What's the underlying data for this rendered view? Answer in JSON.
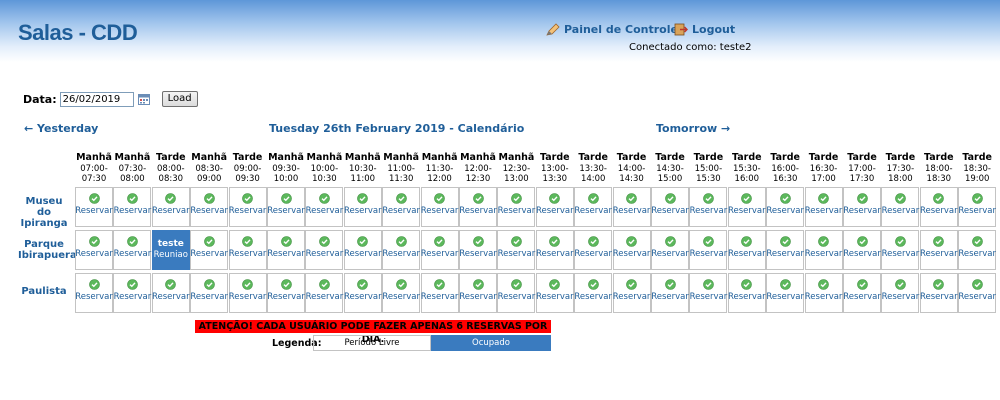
{
  "header": {
    "title": "Salas - CDD",
    "control_panel": "Painel de Controle",
    "logout": "Logout",
    "connected_as": "Conectado como: teste2"
  },
  "date_bar": {
    "label": "Data:",
    "value": "26/02/2019",
    "load_label": "Load"
  },
  "nav": {
    "prev": "← Yesterday",
    "title": "Tuesday 26th February 2019 - Calendário",
    "next": "Tomorrow →"
  },
  "slots": [
    {
      "period": "Manhã",
      "time": "07:00-\n07:30"
    },
    {
      "period": "Manhã",
      "time": "07:30-\n08:00"
    },
    {
      "period": "Tarde",
      "time": "08:00-\n08:30"
    },
    {
      "period": "Manhã",
      "time": "08:30-\n09:00"
    },
    {
      "period": "Tarde",
      "time": "09:00-\n09:30"
    },
    {
      "period": "Manhã",
      "time": "09:30-\n10:00"
    },
    {
      "period": "Manhã",
      "time": "10:00-\n10:30"
    },
    {
      "period": "Manhã",
      "time": "10:30-\n11:00"
    },
    {
      "period": "Manhã",
      "time": "11:00-\n11:30"
    },
    {
      "period": "Manhã",
      "time": "11:30-\n12:00"
    },
    {
      "period": "Manhã",
      "time": "12:00-\n12:30"
    },
    {
      "period": "Manhã",
      "time": "12:30-\n13:00"
    },
    {
      "period": "Tarde",
      "time": "13:00-\n13:30"
    },
    {
      "period": "Tarde",
      "time": "13:30-\n14:00"
    },
    {
      "period": "Tarde",
      "time": "14:00-\n14:30"
    },
    {
      "period": "Tarde",
      "time": "14:30-\n15:00"
    },
    {
      "period": "Tarde",
      "time": "15:00-\n15:30"
    },
    {
      "period": "Tarde",
      "time": "15:30-\n16:00"
    },
    {
      "period": "Tarde",
      "time": "16:00-\n16:30"
    },
    {
      "period": "Tarde",
      "time": "16:30-\n17:00"
    },
    {
      "period": "Tarde",
      "time": "17:00-\n17:30"
    },
    {
      "period": "Tarde",
      "time": "17:30-\n18:00"
    },
    {
      "period": "Tarde",
      "time": "18:00-\n18:30"
    },
    {
      "period": "Tarde",
      "time": "18:30-\n19:00"
    }
  ],
  "rooms": [
    {
      "name": "Museu do\nIpiranga",
      "busy": []
    },
    {
      "name": "Parque\nIbirapuera",
      "busy": [
        {
          "slot": 2,
          "title": "teste",
          "subtitle": "Reuniao"
        }
      ]
    },
    {
      "name": "Paulista",
      "busy": []
    }
  ],
  "reserve_label": "Reservar",
  "warning": "ATENÇÃO! CADA USUÁRIO PODE FAZER APENAS 6 RESERVAS POR DIA.",
  "legend": {
    "label": "Legenda:",
    "free": "Período Livre",
    "busy": "Ocupado"
  },
  "colors": {
    "accent": "#1f5e99",
    "busy": "#3a7bbf",
    "warning": "#ff0000",
    "check": "#5cb85c"
  },
  "icons": {
    "control_panel": "pencil-icon",
    "logout": "logout-icon",
    "date_picker": "calendar-icon",
    "free_slot": "check-circle-icon"
  }
}
